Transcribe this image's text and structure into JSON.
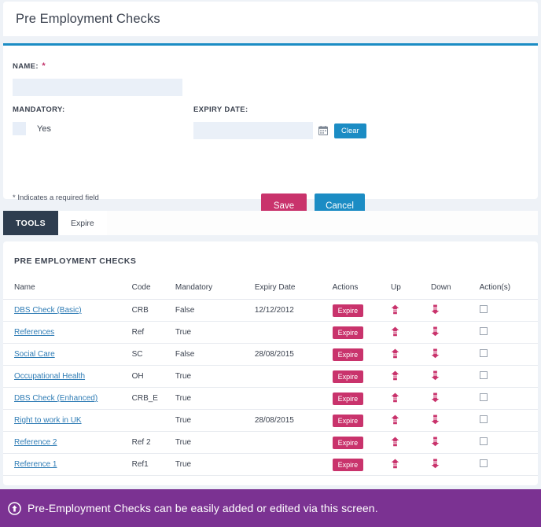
{
  "header": {
    "title": "Pre Employment Checks"
  },
  "form": {
    "name_label": "NAME:",
    "required_marker": "*",
    "name_value": "",
    "name_placeholder": "",
    "mandatory_label": "MANDATORY:",
    "mandatory_option": "Yes",
    "mandatory_checked": false,
    "expiry_label": "EXPIRY DATE:",
    "expiry_value": "",
    "expiry_placeholder": "",
    "calendar_icon": "calendar-icon",
    "clear_label": "Clear",
    "required_note": "* Indicates a required field",
    "save_label": "Save",
    "cancel_label": "Cancel"
  },
  "tabs": {
    "items": [
      {
        "label": "TOOLS",
        "active": true
      },
      {
        "label": "Expire",
        "active": false
      }
    ]
  },
  "table": {
    "caption": "PRE EMPLOYMENT CHECKS",
    "columns": [
      "Name",
      "Code",
      "Mandatory",
      "Expiry Date",
      "Actions",
      "Up",
      "Down",
      "Action(s)"
    ],
    "expire_label": "Expire",
    "up_icon": "arrow-up-icon",
    "down_icon": "arrow-down-icon",
    "checkbox_icon": "checkbox-unchecked",
    "rows": [
      {
        "name": "DBS Check (Basic)",
        "code": "CRB",
        "mandatory": "False",
        "expiry": "12/12/2012",
        "checked": false
      },
      {
        "name": "References",
        "code": "Ref",
        "mandatory": "True",
        "expiry": "",
        "checked": false
      },
      {
        "name": "Social Care",
        "code": "SC",
        "mandatory": "False",
        "expiry": "28/08/2015",
        "checked": false
      },
      {
        "name": "Occupational Health",
        "code": "OH",
        "mandatory": "True",
        "expiry": "",
        "checked": false
      },
      {
        "name": "DBS Check (Enhanced)",
        "code": "CRB_E",
        "mandatory": "True",
        "expiry": "",
        "checked": false
      },
      {
        "name": "Right to work in UK",
        "code": "",
        "mandatory": "True",
        "expiry": "28/08/2015",
        "checked": false
      },
      {
        "name": "Reference 2",
        "code": "Ref 2",
        "mandatory": "True",
        "expiry": "",
        "checked": false
      },
      {
        "name": "Reference 1",
        "code": "Ref1",
        "mandatory": "True",
        "expiry": "",
        "checked": false
      }
    ]
  },
  "footer": {
    "icon": "info-arrow-up-circle-icon",
    "message": "Pre-Employment Checks can be easily added or edited via this screen."
  },
  "colors": {
    "accent_blue": "#1b8cc4",
    "accent_pink": "#c9336c",
    "tab_dark": "#2e3d4f",
    "footer_purple": "#7b3292",
    "page_bg": "#eef2f7",
    "input_bg": "#eaf0f8",
    "link_blue": "#2f7cb5"
  }
}
